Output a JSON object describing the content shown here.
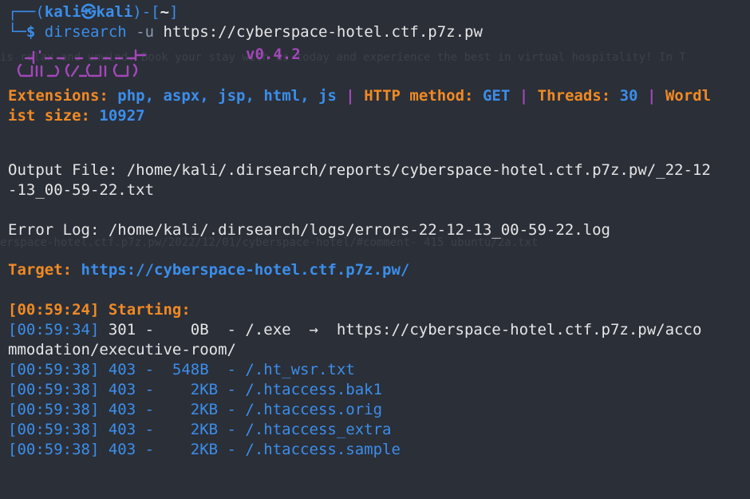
{
  "prompt": {
    "user_host": "kali㉿kali",
    "cwd": "~",
    "prompt_symbol": "$",
    "command": "dirsearch",
    "flag": "-u",
    "url_arg": "https://cyberspace-hotel.ctf.p7z.pw"
  },
  "banner": {
    "version": "v0.4.2"
  },
  "config": {
    "extensions_label": "Extensions:",
    "extensions_value": "php, aspx, jsp, html, js",
    "sep": "|",
    "method_label": "HTTP method:",
    "method_value": "GET",
    "threads_label": "Threads:",
    "threads_value": "30",
    "wordlist_label_part1": "Wordl",
    "wordlist_label_part2": "ist size:",
    "wordlist_value": "10927"
  },
  "output_file": {
    "line1": "Output File: /home/kali/.dirsearch/reports/cyberspace-hotel.ctf.p7z.pw/_22-12",
    "line2": "-13_00-59-22.txt"
  },
  "error_log": "Error Log: /home/kali/.dirsearch/logs/errors-22-12-13_00-59-22.log",
  "target": {
    "label": "Target:",
    "value": "https://cyberspace-hotel.ctf.p7z.pw/"
  },
  "starting": {
    "timestamp": "[00:59:24]",
    "label": "Starting:"
  },
  "results": [
    {
      "ts": "[00:59:34]",
      "text": "301 -    0B  - /.exe  →  https://cyberspace-hotel.ctf.p7z.pw/acco",
      "wrap": "mmodation/executive-room/"
    },
    {
      "ts": "[00:59:38]",
      "text": "403 -  548B  - /.ht_wsr.txt"
    },
    {
      "ts": "[00:59:38]",
      "text": "403 -    2KB - /.htaccess.bak1"
    },
    {
      "ts": "[00:59:38]",
      "text": "403 -    2KB - /.htaccess.orig"
    },
    {
      "ts": "[00:59:38]",
      "text": "403 -    2KB - /.htaccess_extra"
    },
    {
      "ts": "[00:59:38]",
      "text": "403 -    2KB - /.htaccess.sample"
    }
  ]
}
